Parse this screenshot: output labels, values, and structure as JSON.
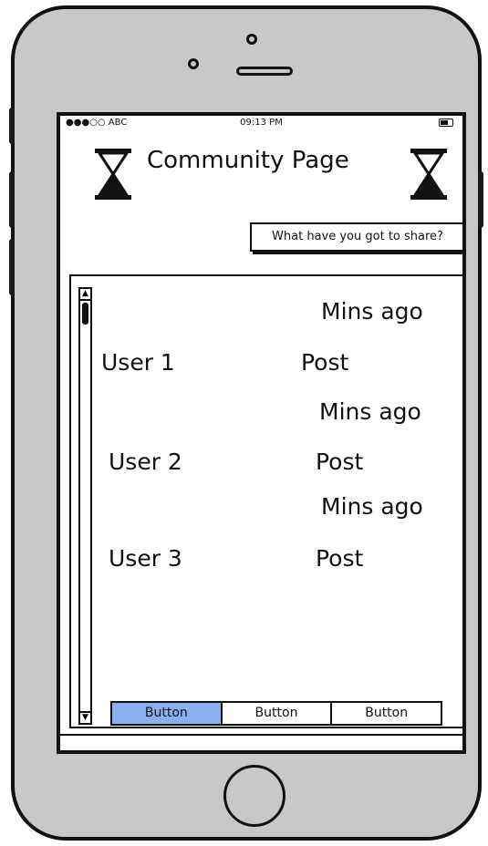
{
  "status_bar": {
    "carrier": "●●●○○ ABC",
    "time": "09:13 PM"
  },
  "header": {
    "title": "Community Page",
    "share_button": "What have you got to share?"
  },
  "feed": {
    "posts": [
      {
        "time": "Mins ago",
        "user": "User 1",
        "post": "Post"
      },
      {
        "time": "Mins ago",
        "user": "User 2",
        "post": "Post"
      },
      {
        "time": "Mins ago",
        "user": "User 3",
        "post": "Post"
      }
    ]
  },
  "tab_bar": {
    "buttons": [
      "Button",
      "Button",
      "Button"
    ],
    "active_index": 0,
    "active_color": "#8ab0f0"
  },
  "icons": {
    "header_left": "hourglass-icon",
    "header_right": "hourglass-icon"
  }
}
